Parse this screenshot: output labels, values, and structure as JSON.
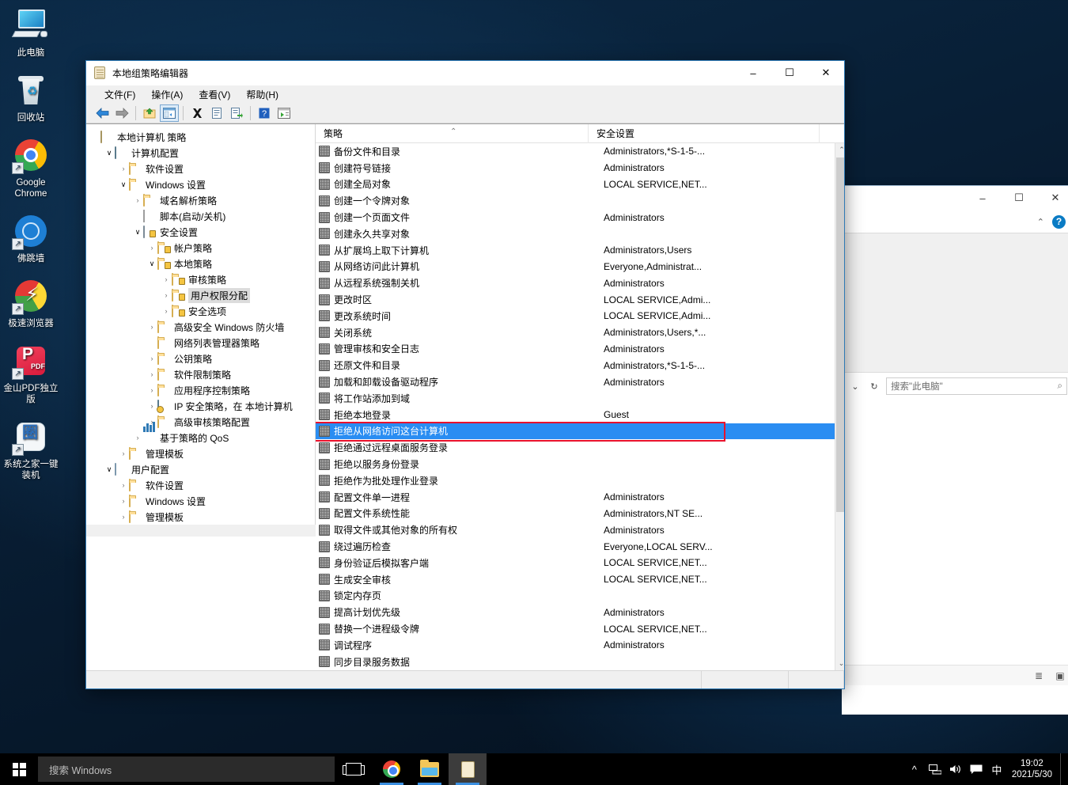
{
  "desktop": {
    "icons": [
      {
        "label": "此电脑",
        "icon": "this-pc-icon"
      },
      {
        "label": "回收站",
        "icon": "recycle-bin-icon"
      },
      {
        "label": "Google Chrome",
        "icon": "chrome-icon"
      },
      {
        "label": "佛跳墙",
        "icon": "fotiaoqiang-icon"
      },
      {
        "label": "极速浏览器",
        "icon": "jisu-browser-icon"
      },
      {
        "label": "金山PDF独立版",
        "icon": "kingsoft-pdf-icon"
      },
      {
        "label": "系统之家一键装机",
        "icon": "xitongzhijia-icon"
      }
    ]
  },
  "explorer_window": {
    "search_placeholder": "搜索\"此电脑\"",
    "minimize_label": "–",
    "maximize_label": "☐",
    "close_label": "✕",
    "ribbon_collapse_label": "⌃",
    "help_label": "?",
    "dropdown_label": "⌄",
    "refresh_label": "↻",
    "search_icon_label": "⌕",
    "details_view_label": "≣",
    "large_icons_view_label": "▣"
  },
  "gpedit": {
    "title": "本地组策略编辑器",
    "title_icon": "mmc-console-icon",
    "window_buttons": {
      "minimize": "–",
      "maximize": "☐",
      "close": "✕"
    },
    "menu": [
      {
        "label": "文件(F)",
        "name": "menu-file"
      },
      {
        "label": "操作(A)",
        "name": "menu-action"
      },
      {
        "label": "查看(V)",
        "name": "menu-view"
      },
      {
        "label": "帮助(H)",
        "name": "menu-help"
      }
    ],
    "toolbar": [
      {
        "name": "back-button",
        "glyph": "←",
        "kind": "back"
      },
      {
        "name": "forward-button",
        "glyph": "→",
        "kind": "forward"
      },
      {
        "name": "up-one-level-button",
        "glyph": "↰",
        "kind": "up"
      },
      {
        "name": "show-hide-tree-button",
        "glyph": "▤",
        "kind": "tree",
        "pressed": true
      },
      {
        "name": "delete-button",
        "glyph": "✕",
        "kind": "delete"
      },
      {
        "name": "properties-button",
        "glyph": "☰",
        "kind": "properties"
      },
      {
        "name": "export-list-button",
        "glyph": "⇨",
        "kind": "export"
      },
      {
        "name": "help-button",
        "glyph": "?",
        "kind": "help"
      },
      {
        "name": "show-console-tree-button",
        "glyph": "▦",
        "kind": "console"
      }
    ],
    "tree": {
      "root_label": "本地计算机 策略",
      "nodes": [
        {
          "label": "本地计算机 策略",
          "indent": 0,
          "chev": "",
          "icon": "mmc"
        },
        {
          "label": "计算机配置",
          "indent": 1,
          "chev": "open",
          "icon": "computer"
        },
        {
          "label": "软件设置",
          "indent": 2,
          "chev": "closed",
          "icon": "folder"
        },
        {
          "label": "Windows 设置",
          "indent": 2,
          "chev": "open",
          "icon": "folder"
        },
        {
          "label": "域名解析策略",
          "indent": 3,
          "chev": "closed",
          "icon": "folder"
        },
        {
          "label": "脚本(启动/关机)",
          "indent": 3,
          "chev": "",
          "icon": "script"
        },
        {
          "label": "安全设置",
          "indent": 3,
          "chev": "open",
          "icon": "shield"
        },
        {
          "label": "帐户策略",
          "indent": 4,
          "chev": "closed",
          "icon": "folderlock"
        },
        {
          "label": "本地策略",
          "indent": 4,
          "chev": "open",
          "icon": "folderlock"
        },
        {
          "label": "审核策略",
          "indent": 5,
          "chev": "closed",
          "icon": "folderlock"
        },
        {
          "label": "用户权限分配",
          "indent": 5,
          "chev": "closed",
          "icon": "folderlock",
          "selected": true
        },
        {
          "label": "安全选项",
          "indent": 5,
          "chev": "closed",
          "icon": "folderlock"
        },
        {
          "label": "高级安全 Windows 防火墙",
          "indent": 4,
          "chev": "closed",
          "icon": "folder"
        },
        {
          "label": "网络列表管理器策略",
          "indent": 4,
          "chev": "",
          "icon": "folder"
        },
        {
          "label": "公钥策略",
          "indent": 4,
          "chev": "closed",
          "icon": "folder"
        },
        {
          "label": "软件限制策略",
          "indent": 4,
          "chev": "closed",
          "icon": "folder"
        },
        {
          "label": "应用程序控制策略",
          "indent": 4,
          "chev": "closed",
          "icon": "folder"
        },
        {
          "label": "IP 安全策略，在 本地计算机",
          "indent": 4,
          "chev": "closed",
          "icon": "ipsec"
        },
        {
          "label": "高级审核策略配置",
          "indent": 4,
          "chev": "closed",
          "icon": "folder"
        },
        {
          "label": "基于策略的 QoS",
          "indent": 3,
          "chev": "closed",
          "icon": "qos"
        },
        {
          "label": "管理模板",
          "indent": 2,
          "chev": "closed",
          "icon": "folder"
        },
        {
          "label": "用户配置",
          "indent": 1,
          "chev": "open",
          "icon": "users"
        },
        {
          "label": "软件设置",
          "indent": 2,
          "chev": "closed",
          "icon": "folder"
        },
        {
          "label": "Windows 设置",
          "indent": 2,
          "chev": "closed",
          "icon": "folder"
        },
        {
          "label": "管理模板",
          "indent": 2,
          "chev": "closed",
          "icon": "folder"
        }
      ]
    },
    "list": {
      "columns": [
        "策略",
        "安全设置"
      ],
      "sort_indicator": "⌃",
      "rows": [
        {
          "name": "备份文件和目录",
          "value": "Administrators,*S-1-5-..."
        },
        {
          "name": "创建符号链接",
          "value": "Administrators"
        },
        {
          "name": "创建全局对象",
          "value": "LOCAL SERVICE,NET..."
        },
        {
          "name": "创建一个令牌对象",
          "value": ""
        },
        {
          "name": "创建一个页面文件",
          "value": "Administrators"
        },
        {
          "name": "创建永久共享对象",
          "value": ""
        },
        {
          "name": "从扩展坞上取下计算机",
          "value": "Administrators,Users"
        },
        {
          "name": "从网络访问此计算机",
          "value": "Everyone,Administrat..."
        },
        {
          "name": "从远程系统强制关机",
          "value": "Administrators"
        },
        {
          "name": "更改时区",
          "value": "LOCAL SERVICE,Admi..."
        },
        {
          "name": "更改系统时间",
          "value": "LOCAL SERVICE,Admi..."
        },
        {
          "name": "关闭系统",
          "value": "Administrators,Users,*..."
        },
        {
          "name": "管理审核和安全日志",
          "value": "Administrators"
        },
        {
          "name": "还原文件和目录",
          "value": "Administrators,*S-1-5-..."
        },
        {
          "name": "加载和卸载设备驱动程序",
          "value": "Administrators"
        },
        {
          "name": "将工作站添加到域",
          "value": ""
        },
        {
          "name": "拒绝本地登录",
          "value": "Guest"
        },
        {
          "name": "拒绝从网络访问这台计算机",
          "value": "",
          "selected": true
        },
        {
          "name": "拒绝通过远程桌面服务登录",
          "value": ""
        },
        {
          "name": "拒绝以服务身份登录",
          "value": ""
        },
        {
          "name": "拒绝作为批处理作业登录",
          "value": ""
        },
        {
          "name": "配置文件单一进程",
          "value": "Administrators"
        },
        {
          "name": "配置文件系统性能",
          "value": "Administrators,NT SE..."
        },
        {
          "name": "取得文件或其他对象的所有权",
          "value": "Administrators"
        },
        {
          "name": "绕过遍历检查",
          "value": "Everyone,LOCAL SERV..."
        },
        {
          "name": "身份验证后模拟客户端",
          "value": "LOCAL SERVICE,NET..."
        },
        {
          "name": "生成安全审核",
          "value": "LOCAL SERVICE,NET..."
        },
        {
          "name": "锁定内存页",
          "value": ""
        },
        {
          "name": "提高计划优先级",
          "value": "Administrators"
        },
        {
          "name": "替换一个进程级令牌",
          "value": "LOCAL SERVICE,NET..."
        },
        {
          "name": "调试程序",
          "value": "Administrators"
        },
        {
          "name": "同步目录服务数据",
          "value": ""
        }
      ],
      "scroll_up_label": "⌃",
      "scroll_down_label": "⌄",
      "highlight_color": "#e8112d",
      "selection_color": "#2a8df2"
    }
  },
  "taskbar": {
    "search_placeholder": "搜索 Windows",
    "start_name": "start-button",
    "items": [
      {
        "name": "task-view-button",
        "label": "任务视图"
      },
      {
        "name": "taskbar-chrome",
        "label": "Google Chrome"
      },
      {
        "name": "taskbar-file-explorer",
        "label": "文件资源管理器"
      },
      {
        "name": "taskbar-gpedit",
        "label": "本地组策略编辑器"
      }
    ],
    "tray": [
      {
        "name": "show-hidden-icons-button",
        "glyph": "⌃"
      },
      {
        "name": "network-icon",
        "glyph": "὚7"
      },
      {
        "name": "volume-icon",
        "glyph": "ὐA"
      },
      {
        "name": "action-center-icon",
        "glyph": "ὊC"
      },
      {
        "name": "ime-icon",
        "glyph": "中"
      }
    ],
    "clock": {
      "time": "19:02",
      "date": "2021/5/30"
    }
  }
}
